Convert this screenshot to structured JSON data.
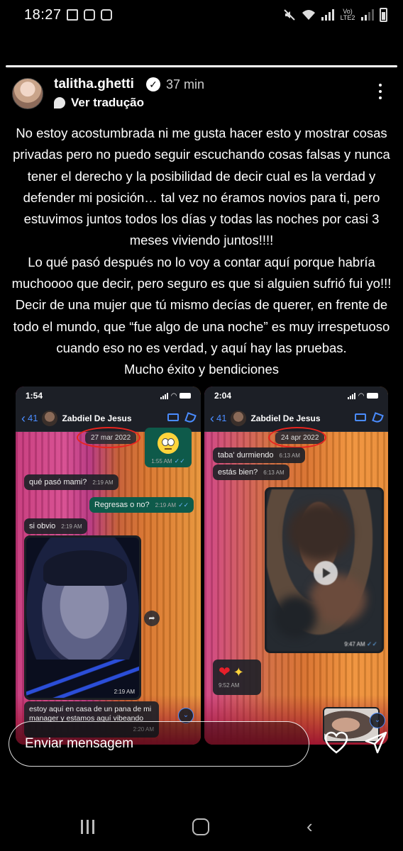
{
  "status_bar": {
    "time": "18:27",
    "left_icons": [
      "gallery-icon",
      "instagram-icon",
      "instagram-icon"
    ],
    "network_label": "Vo) LTE2",
    "right_icons": [
      "mute-icon",
      "wifi-icon",
      "signal-icon",
      "signal-icon",
      "battery-icon"
    ]
  },
  "story": {
    "progress": 1.0,
    "username": "talitha.ghetti",
    "verified": true,
    "time_ago": "37 min",
    "translate_label": "Ver tradução",
    "text_paragraphs": [
      "No estoy acostumbrada ni me gusta hacer esto y mostrar cosas privadas pero no puedo seguir escuchando cosas falsas y nunca tener el derecho y la posibilidad de decir cual es la verdad y defender mi posición… tal vez no éramos novios para ti, pero estuvimos juntos todos los días y todas las noches por casi 3 meses viviendo juntos!!!!",
      "Lo qué pasó después no lo voy a contar aquí porque habría muchoooo que decir, pero seguro es que si alguien sufrió  fui yo!!!",
      "Decir de una mujer que tú mismo decías de querer, en frente de todo el mundo, que “fue algo de una noche” es muy irrespetuoso cuando eso no es verdad, y aquí hay las pruebas.",
      "Mucho éxito y bendiciones"
    ]
  },
  "screenshot_left": {
    "time": "1:54",
    "back_count": "41",
    "contact_name": "Zabdiel De Jesus",
    "date_pill": "27 mar 2022",
    "messages": [
      {
        "dir": "out",
        "kind": "emoji",
        "emoji": "rolling-eyes-emoji",
        "time": "1:55 AM"
      },
      {
        "dir": "in",
        "text": "qué pasó mami?",
        "time": "2:19 AM"
      },
      {
        "dir": "out",
        "text": "Regresas o no?",
        "time": "2:19 AM"
      },
      {
        "dir": "in",
        "text": "si obvio",
        "time": "2:19 AM"
      },
      {
        "dir": "in",
        "kind": "photo",
        "time": "2:19 AM"
      },
      {
        "dir": "in",
        "text": "estoy aquí en casa de un pana de mi manager y estamos aquí vibeando",
        "time": "2:20 AM"
      }
    ]
  },
  "screenshot_right": {
    "time": "2:04",
    "back_count": "41",
    "contact_name": "Zabdiel De Jesus",
    "date_pill": "24 apr 2022",
    "messages": [
      {
        "dir": "in",
        "text": "taba' durmiendo",
        "time": "6:13 AM"
      },
      {
        "dir": "in",
        "text": "estás bien?",
        "time": "6:13 AM"
      },
      {
        "dir": "out",
        "kind": "video",
        "time": "9:47 AM"
      },
      {
        "dir": "in",
        "kind": "emoji",
        "emoji": "heart-sparkles-emoji",
        "time": "9:52 AM"
      }
    ]
  },
  "reply": {
    "placeholder": "Enviar mensagem"
  },
  "nav_icons": [
    "recents-icon",
    "home-icon",
    "back-icon"
  ]
}
